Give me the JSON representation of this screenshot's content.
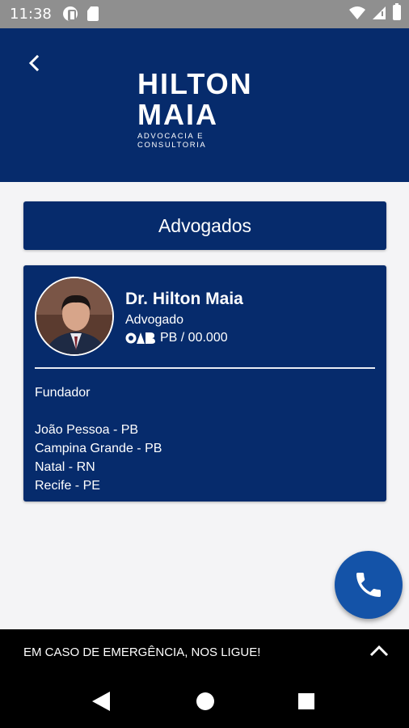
{
  "status_bar": {
    "time": "11:38"
  },
  "header": {
    "logo_line1": "HILTON",
    "logo_line2": "MAIA",
    "logo_tagline": "ADVOCACIA E CONSULTORIA"
  },
  "section": {
    "title": "Advogados"
  },
  "lawyer": {
    "name": "Dr. Hilton Maia",
    "role": "Advogado",
    "oab_label": "OAB",
    "oab_number": "PB / 00.000",
    "title": "Fundador",
    "locations": [
      "João Pessoa - PB",
      "Campina Grande - PB",
      "Natal - RN",
      "Recife - PE"
    ]
  },
  "emergency": {
    "text": "EM CASO DE EMERGÊNCIA, NOS LIGUE!"
  },
  "icons": {
    "back": "chevron-left-icon",
    "phone": "phone-icon",
    "expand": "chevron-up-icon"
  },
  "colors": {
    "primary": "#062b6c",
    "fab": "#1453a8",
    "background": "#f4f4f6"
  }
}
